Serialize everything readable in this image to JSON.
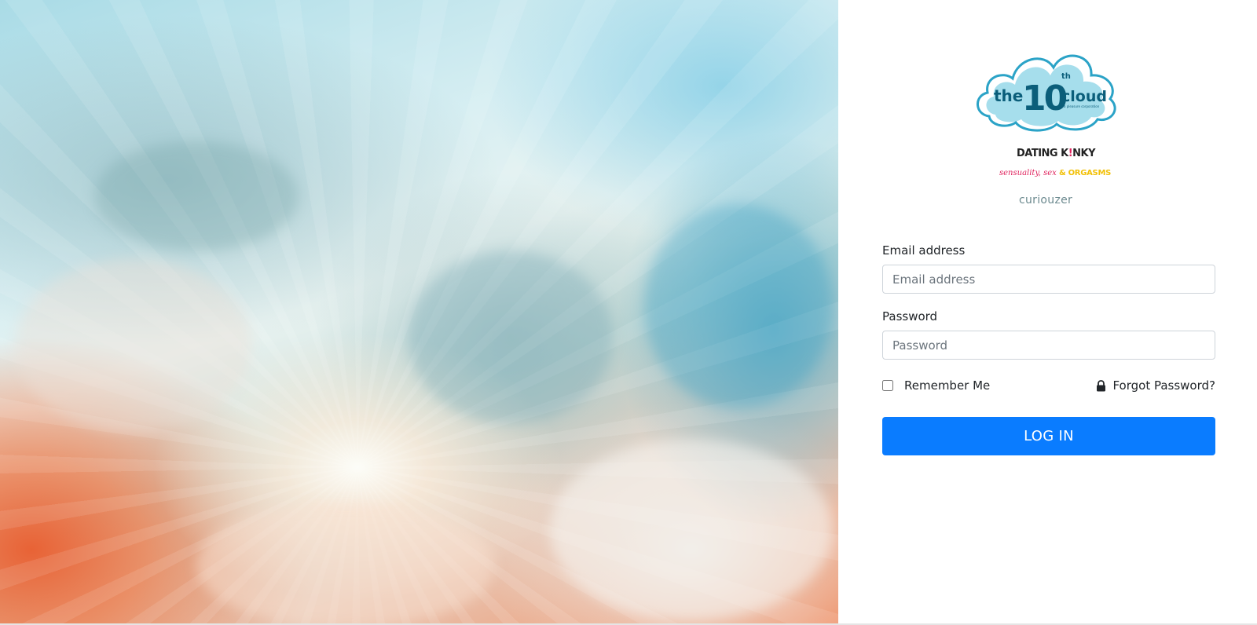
{
  "brand": {
    "logo_main": "the 10th cloud",
    "logo_tagline": "a pleasure corporation",
    "logo_sub_1": "DATING KINKY",
    "logo_sub_2_script": "sensuality, sex",
    "logo_sub_2_bold": "& ORGASMS",
    "logo_sub_3": "curiouzer"
  },
  "form": {
    "email": {
      "label": "Email address",
      "placeholder": "Email address",
      "value": ""
    },
    "password": {
      "label": "Password",
      "placeholder": "Password",
      "value": ""
    },
    "remember_me": {
      "label": "Remember Me",
      "checked": false
    },
    "forgot_password": {
      "label": "Forgot Password?",
      "icon": "lock-icon"
    },
    "submit_label": "LOG IN"
  },
  "colors": {
    "primary": "#0a7cff",
    "logo_teal": "#2ba3c7",
    "accent_pink": "#e0245e",
    "accent_yellow": "#f2c10a"
  }
}
